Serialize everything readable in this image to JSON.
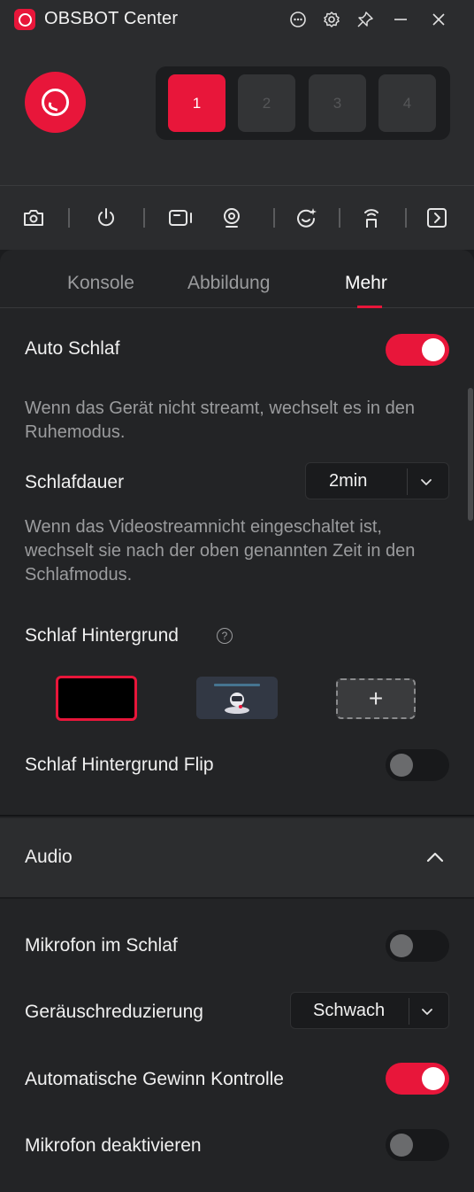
{
  "app": {
    "title": "OBSBOT Center"
  },
  "title_bar_icons": [
    "more-icon",
    "settings-icon",
    "pin-icon",
    "minimize-icon",
    "close-icon"
  ],
  "devices": [
    {
      "label": "1",
      "active": true
    },
    {
      "label": "2",
      "active": false
    },
    {
      "label": "3",
      "active": false
    },
    {
      "label": "4",
      "active": false
    }
  ],
  "toolbar_icons": [
    "camera-snapshot-icon",
    "power-icon",
    "record-icon",
    "webcam-icon",
    "ai-tracking-icon",
    "remote-icon",
    "expand-panel-icon"
  ],
  "tabs": [
    {
      "label": "Konsole",
      "active": false
    },
    {
      "label": "Abbildung",
      "active": false
    },
    {
      "label": "Mehr",
      "active": true
    }
  ],
  "sleep": {
    "auto_sleep_label": "Auto Schlaf",
    "auto_sleep_on": true,
    "auto_sleep_desc": "Wenn das Gerät nicht streamt, wechselt es in den Ruhemodus.",
    "duration_label": "Schlafdauer",
    "duration_value": "2min",
    "duration_desc": "Wenn das Videostreamnicht eingeschaltet ist, wechselt sie nach der oben genannten Zeit in den Schlafmodus.",
    "background_label": "Schlaf Hintergrund",
    "help_glyph": "?",
    "add_glyph": "+",
    "background_flip_label": "Schlaf Hintergrund Flip",
    "background_flip_on": false
  },
  "audio": {
    "section_label": "Audio",
    "expanded": true,
    "mic_sleep_label": "Mikrofon im Schlaf",
    "mic_sleep_on": false,
    "noise_label": "Geräuschreduzierung",
    "noise_value": "Schwach",
    "agc_label": "Automatische Gewinn Kontrolle",
    "agc_on": true,
    "mic_disable_label": "Mikrofon deaktivieren",
    "mic_disable_on": false
  },
  "colors": {
    "accent": "#e8163a",
    "panel": "#232426",
    "header": "#2b2c2e"
  }
}
